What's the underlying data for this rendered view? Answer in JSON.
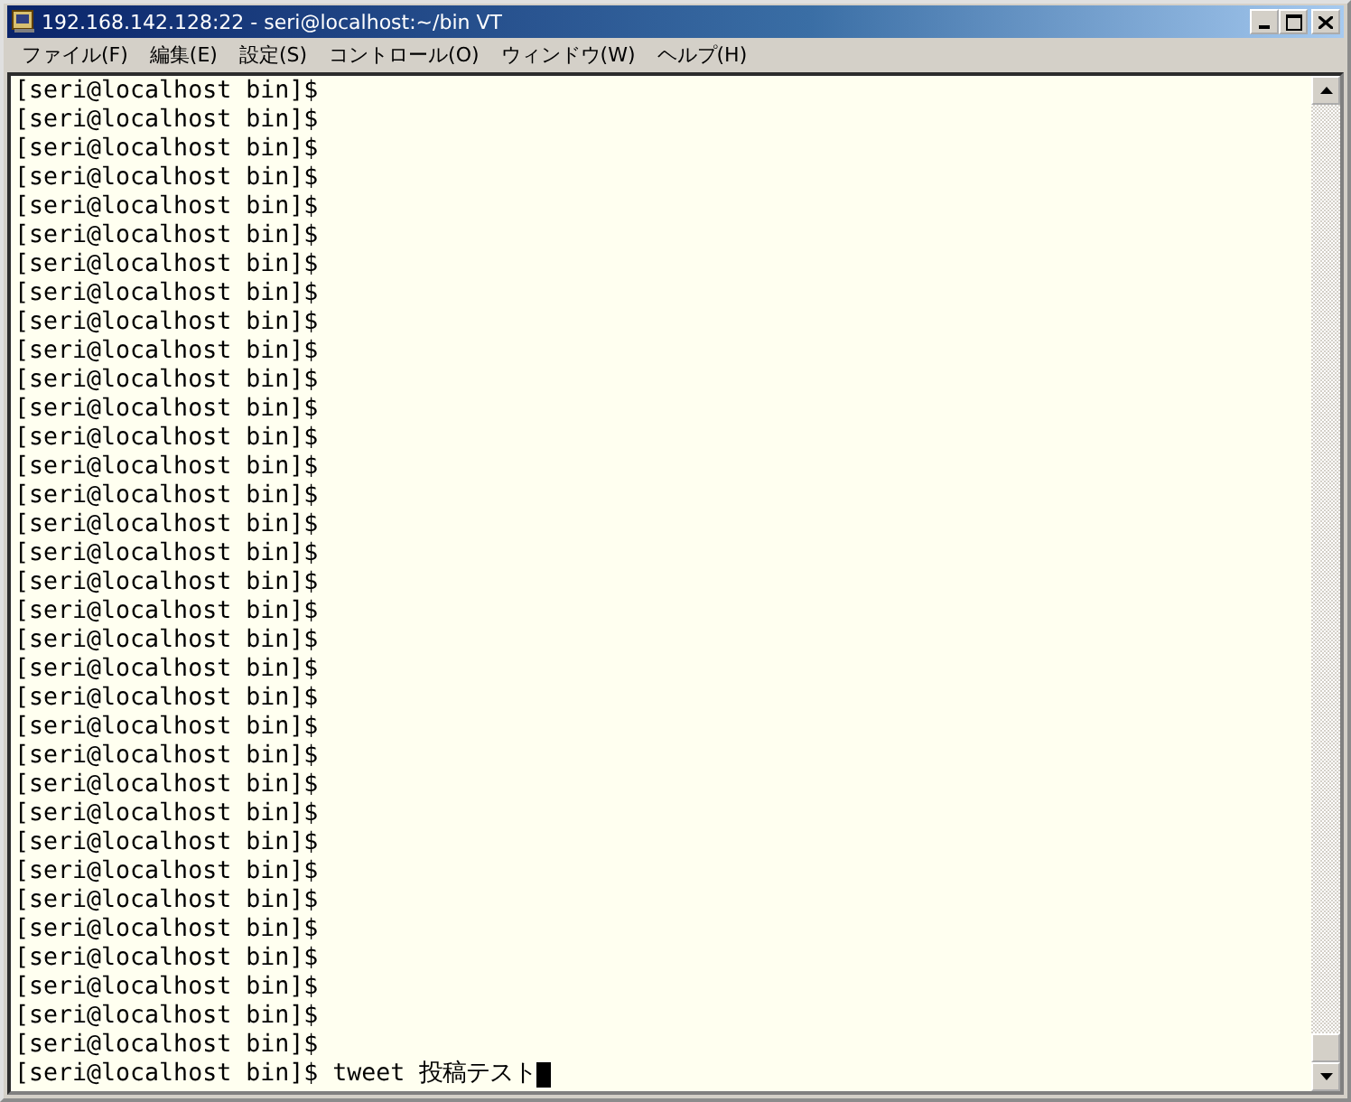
{
  "window": {
    "title": "192.168.142.128:22 - seri@localhost:~/bin VT"
  },
  "menu": [
    "ファイル(F)",
    "編集(E)",
    "設定(S)",
    "コントロール(O)",
    "ウィンドウ(W)",
    "ヘルプ(H)"
  ],
  "terminal": {
    "lines": [
      {
        "text": "[seri@localhost bin]$",
        "cursor": false
      },
      {
        "text": "[seri@localhost bin]$",
        "cursor": false
      },
      {
        "text": "[seri@localhost bin]$",
        "cursor": false
      },
      {
        "text": "[seri@localhost bin]$",
        "cursor": false
      },
      {
        "text": "[seri@localhost bin]$",
        "cursor": false
      },
      {
        "text": "[seri@localhost bin]$",
        "cursor": false
      },
      {
        "text": "[seri@localhost bin]$",
        "cursor": false
      },
      {
        "text": "[seri@localhost bin]$",
        "cursor": false
      },
      {
        "text": "[seri@localhost bin]$",
        "cursor": false
      },
      {
        "text": "[seri@localhost bin]$",
        "cursor": false
      },
      {
        "text": "[seri@localhost bin]$",
        "cursor": false
      },
      {
        "text": "[seri@localhost bin]$",
        "cursor": false
      },
      {
        "text": "[seri@localhost bin]$",
        "cursor": false
      },
      {
        "text": "[seri@localhost bin]$",
        "cursor": false
      },
      {
        "text": "[seri@localhost bin]$",
        "cursor": false
      },
      {
        "text": "[seri@localhost bin]$",
        "cursor": false
      },
      {
        "text": "[seri@localhost bin]$",
        "cursor": false
      },
      {
        "text": "[seri@localhost bin]$",
        "cursor": false
      },
      {
        "text": "[seri@localhost bin]$",
        "cursor": false
      },
      {
        "text": "[seri@localhost bin]$",
        "cursor": false
      },
      {
        "text": "[seri@localhost bin]$",
        "cursor": false
      },
      {
        "text": "[seri@localhost bin]$",
        "cursor": false
      },
      {
        "text": "[seri@localhost bin]$",
        "cursor": false
      },
      {
        "text": "[seri@localhost bin]$",
        "cursor": false
      },
      {
        "text": "[seri@localhost bin]$",
        "cursor": false
      },
      {
        "text": "[seri@localhost bin]$",
        "cursor": false
      },
      {
        "text": "[seri@localhost bin]$",
        "cursor": false
      },
      {
        "text": "[seri@localhost bin]$",
        "cursor": false
      },
      {
        "text": "[seri@localhost bin]$",
        "cursor": false
      },
      {
        "text": "[seri@localhost bin]$",
        "cursor": false
      },
      {
        "text": "[seri@localhost bin]$",
        "cursor": false
      },
      {
        "text": "[seri@localhost bin]$",
        "cursor": false
      },
      {
        "text": "[seri@localhost bin]$",
        "cursor": false
      },
      {
        "text": "[seri@localhost bin]$",
        "cursor": false
      },
      {
        "text": "[seri@localhost bin]$ tweet 投稿テスト",
        "cursor": true
      }
    ]
  }
}
